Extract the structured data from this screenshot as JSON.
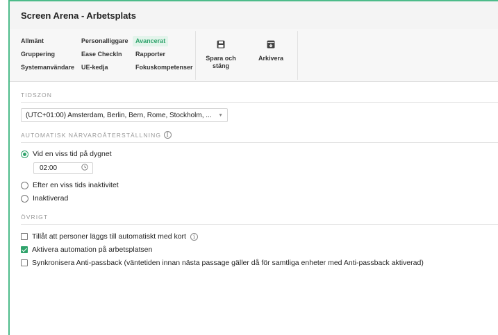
{
  "window": {
    "title": "Screen Arena - Arbetsplats",
    "close_glyph": "×"
  },
  "ribbon": {
    "tabs": [
      [
        "Allmänt",
        "Personalliggare",
        "Avancerat"
      ],
      [
        "Gruppering",
        "Ease CheckIn",
        "Rapporter"
      ],
      [
        "Systemanvändare",
        "UE-kedja",
        "Fokuskompetenser"
      ]
    ],
    "active_tab": "Avancerat",
    "save_close_label_1": "Spara och",
    "save_close_label_2": "stäng",
    "archive_label": "Arkivera"
  },
  "timezone": {
    "section_title": "TIDSZON",
    "selected": "(UTC+01:00) Amsterdam, Berlin, Bern, Rome, Stockholm, ..."
  },
  "auto_reset": {
    "section_title": "AUTOMATISK NÄRVAROÅTERSTÄLLNING",
    "option_time": "Vid en viss tid på dygnet",
    "time_value": "02:00",
    "option_inactivity": "Efter en viss tids inaktivitet",
    "option_disabled": "Inaktiverad",
    "selected": "time"
  },
  "other": {
    "section_title": "ÖVRIGT",
    "opt_auto_add": "Tillåt att personer läggs till automatiskt med kort",
    "opt_automation": "Aktivera automation på arbetsplatsen",
    "opt_antipassback": "Synkronisera Anti-passback (väntetiden innan nästa passage gäller då för samtliga enheter med Anti-passback aktiverad)",
    "auto_add_checked": false,
    "automation_checked": true,
    "antipassback_checked": false
  },
  "colors": {
    "accent": "#2fa36b",
    "border": "#4dbb8a"
  }
}
